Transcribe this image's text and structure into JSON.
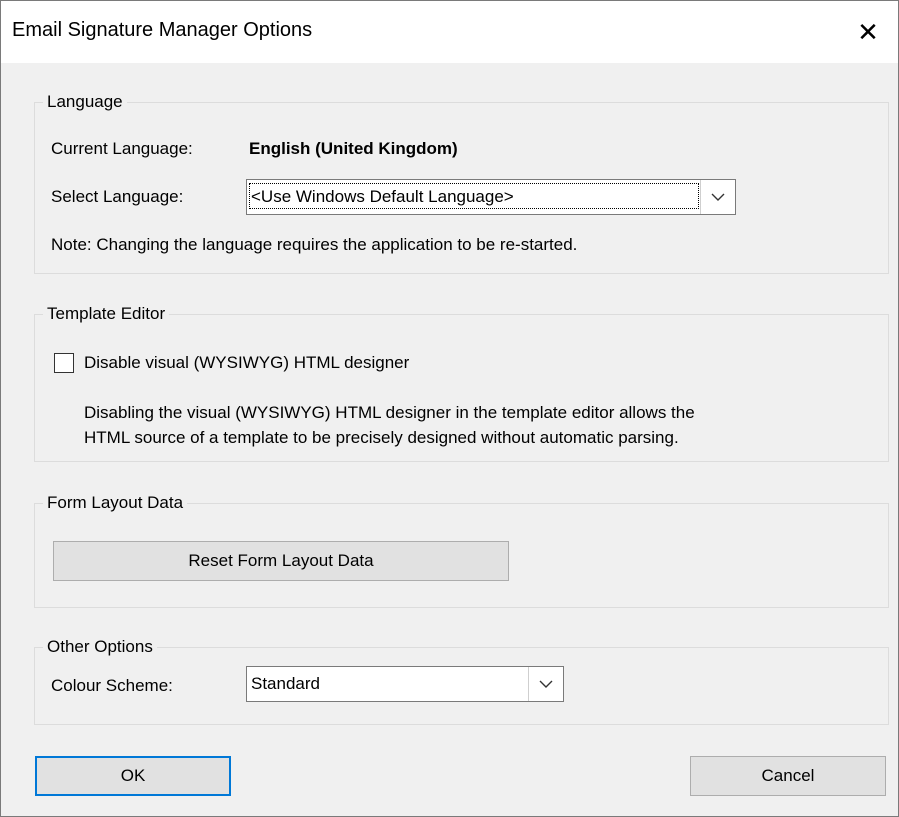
{
  "window": {
    "title": "Email Signature Manager Options",
    "close_glyph": "✕"
  },
  "language": {
    "group_label": "Language",
    "current_label": "Current Language:",
    "current_value": "English (United Kingdom)",
    "select_label": "Select Language:",
    "select_value": "<Use Windows Default Language>",
    "note": "Note: Changing the language requires the application to be re-started."
  },
  "template_editor": {
    "group_label": "Template Editor",
    "checkbox_label": "Disable visual (WYSIWYG) HTML designer",
    "checked": false,
    "description_line1": "Disabling the visual (WYSIWYG) HTML designer in the template editor allows the",
    "description_line2": "HTML source of a template to be precisely designed without automatic parsing."
  },
  "form_layout": {
    "group_label": "Form Layout Data",
    "reset_button": "Reset Form Layout Data"
  },
  "other_options": {
    "group_label": "Other Options",
    "colour_label": "Colour Scheme:",
    "colour_value": "Standard"
  },
  "buttons": {
    "ok": "OK",
    "cancel": "Cancel"
  },
  "icons": {
    "close": "close-icon",
    "dropdown": "chevron-down-icon"
  },
  "colors": {
    "focus_border": "#0078d7",
    "dialog_bg": "#f0f0f0"
  }
}
